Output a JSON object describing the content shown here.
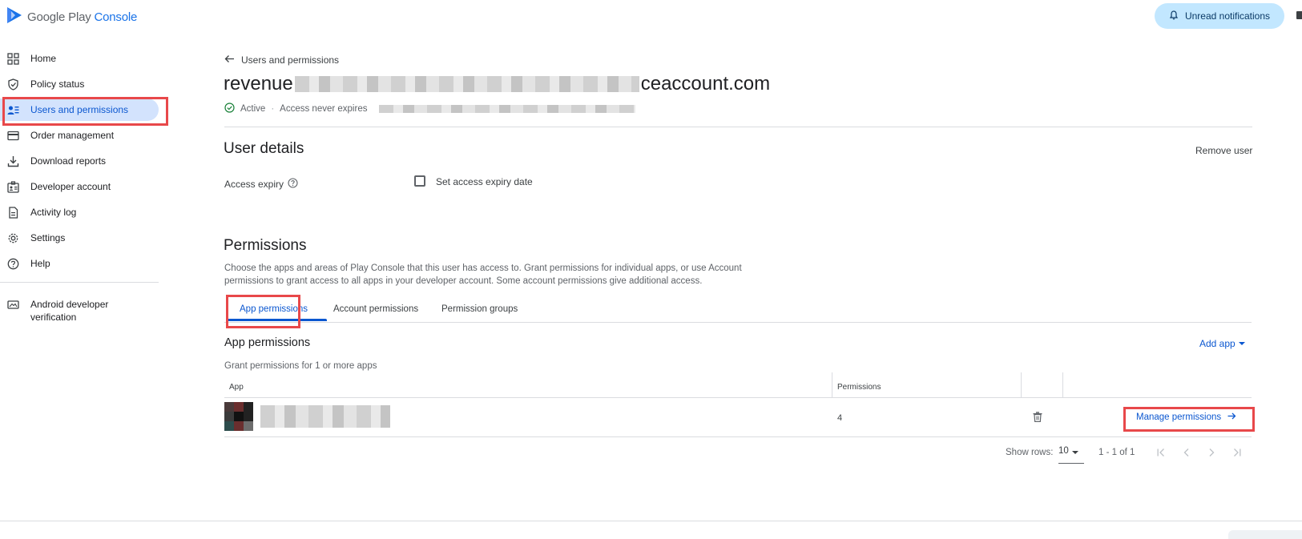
{
  "app": {
    "logo_text_primary": "Google Play ",
    "logo_text_accent": "Console"
  },
  "header": {
    "notifications_label": "Unread notifications"
  },
  "sidebar": {
    "items": [
      {
        "label": "Home",
        "icon": "grid-icon"
      },
      {
        "label": "Policy status",
        "icon": "shield-icon"
      },
      {
        "label": "Users and permissions",
        "icon": "users-icon",
        "active": true
      },
      {
        "label": "Order management",
        "icon": "credit-card-icon"
      },
      {
        "label": "Download reports",
        "icon": "download-icon"
      },
      {
        "label": "Developer account",
        "icon": "developer-account-icon"
      },
      {
        "label": "Activity log",
        "icon": "document-icon"
      },
      {
        "label": "Settings",
        "icon": "gear-icon"
      },
      {
        "label": "Help",
        "icon": "help-icon"
      },
      {
        "label": "Android developer verification",
        "icon": "verification-icon"
      }
    ]
  },
  "page": {
    "breadcrumb": "Users and permissions",
    "email_prefix": "revenue",
    "email_suffix": "ceaccount.com",
    "status": "Active",
    "access_expiry_status": "Access never expires"
  },
  "user_details": {
    "title": "User details",
    "remove_user_label": "Remove user",
    "access_expiry_label": "Access expiry",
    "set_expiry_checkbox_label": "Set access expiry date",
    "set_expiry_checked": false
  },
  "permissions": {
    "title": "Permissions",
    "description": "Choose the apps and areas of Play Console that this user has access to. Grant permissions for individual apps, or use Account permissions to grant access to all apps in your developer account. Some account permissions give additional access.",
    "tabs": [
      {
        "label": "App permissions",
        "active": true
      },
      {
        "label": "Account permissions",
        "active": false
      },
      {
        "label": "Permission groups",
        "active": false
      }
    ],
    "app_permissions_title": "App permissions",
    "add_app_label": "Add app",
    "grant_text": "Grant permissions for 1 or more apps",
    "table": {
      "columns": [
        "App",
        "Permissions"
      ],
      "rows": [
        {
          "permissions": "4",
          "action_label": "Manage permissions"
        }
      ]
    },
    "pagination": {
      "show_rows_label": "Show rows:",
      "rows_value": "10",
      "range": "1 - 1 of 1"
    }
  },
  "colors": {
    "accent": "#0b57d0",
    "highlight_box": "#e8484a",
    "active_nav_bg": "#d3e3fd",
    "notif_bg": "#c2e7ff",
    "status_ok": "#188038"
  }
}
